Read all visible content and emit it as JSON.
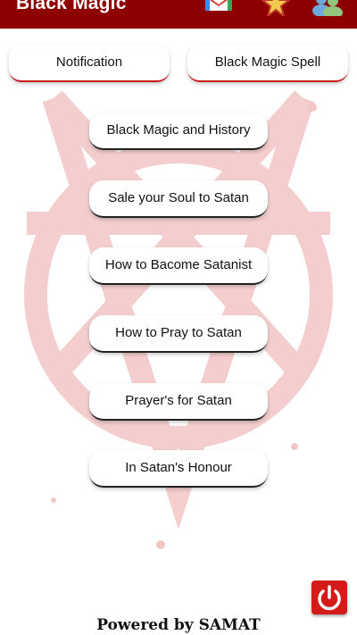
{
  "appbar": {
    "title": "Black Magic",
    "icons": [
      "gmail-icon",
      "star-icon",
      "users-icon"
    ]
  },
  "top_buttons": {
    "notification": "Notification",
    "spell": "Black Magic Spell"
  },
  "menu": [
    "Black Magic and History",
    "Sale your Soul to Satan",
    "How to Bacome Satanist",
    "How to Pray to Satan",
    "Prayer's for Satan",
    "In Satan's Honour"
  ],
  "footer": "Powered by SAMAT",
  "colors": {
    "appbar": "#8e0000",
    "accent": "#c8141a",
    "power": "#d51a1a"
  }
}
